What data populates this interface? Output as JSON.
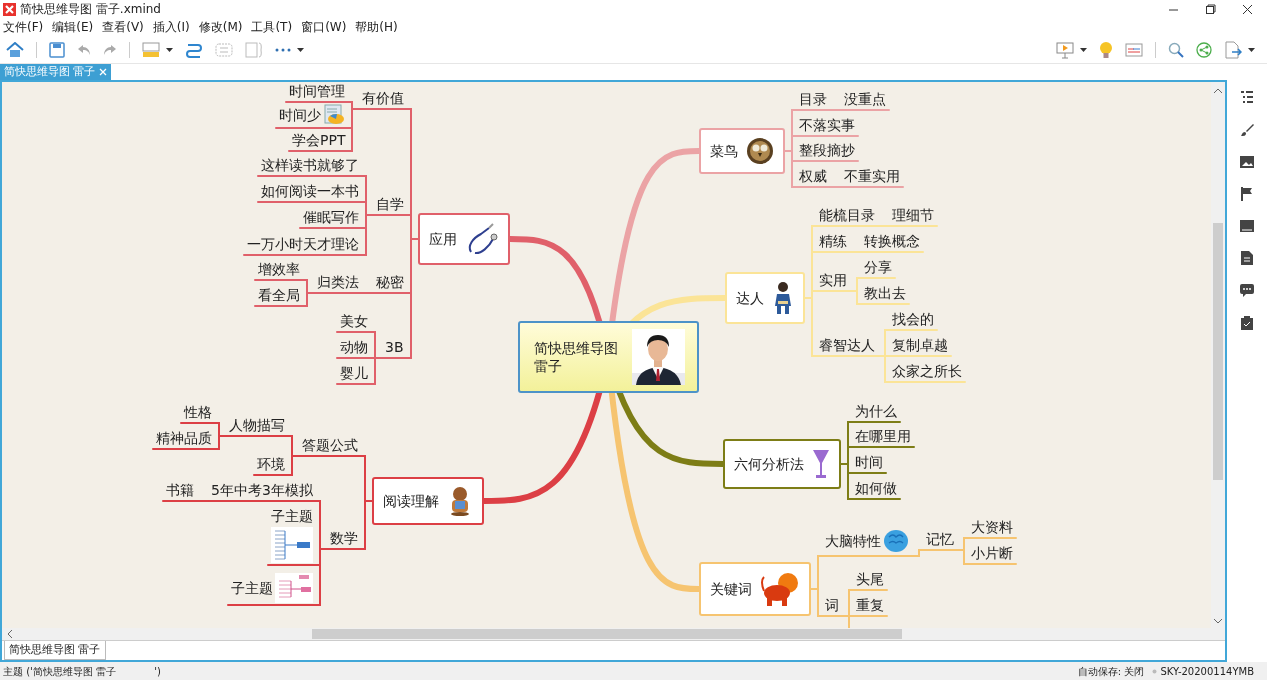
{
  "window": {
    "title": "简快思维导图 雷子.xmind"
  },
  "menu": [
    "文件(F)",
    "编辑(E)",
    "查看(V)",
    "插入(I)",
    "修改(M)",
    "工具(T)",
    "窗口(W)",
    "帮助(H)"
  ],
  "editor_tab": {
    "label": "简快思维导图 雷子"
  },
  "mindmap": {
    "central": {
      "lines": [
        "简快思维导图",
        "雷子"
      ]
    },
    "branches": [
      {
        "label": "应用",
        "color": "#e0606a",
        "children": [
          {
            "label": "有价值",
            "children": [
              {
                "label": "时间管理"
              },
              {
                "label": "时间少"
              },
              {
                "label": "学会PPT"
              }
            ]
          },
          {
            "label": "自学",
            "children": [
              {
                "label": "这样读书就够了"
              },
              {
                "label": "如何阅读一本书"
              },
              {
                "label": "催眠写作"
              },
              {
                "label": "一万小时天才理论"
              }
            ]
          },
          {
            "label": "秘密",
            "children": [
              {
                "label": "归类法",
                "children": [
                  {
                    "label": "增效率"
                  },
                  {
                    "label": "看全局"
                  }
                ]
              }
            ]
          },
          {
            "label": "3B",
            "children": [
              {
                "label": "美女"
              },
              {
                "label": "动物"
              },
              {
                "label": "婴儿"
              }
            ]
          }
        ]
      },
      {
        "label": "阅读理解",
        "color": "#dc3f45",
        "children": [
          {
            "label": "答题公式",
            "children": [
              {
                "label": "人物描写",
                "children": [
                  {
                    "label": "性格"
                  },
                  {
                    "label": "精神品质"
                  }
                ]
              },
              {
                "label": "环境"
              }
            ]
          },
          {
            "label": "数学",
            "children": [
              {
                "label": "5年中考3年模拟",
                "children": [
                  {
                    "label": "书籍"
                  }
                ]
              },
              {
                "label": "子主题"
              },
              {
                "label": "子主题"
              }
            ]
          }
        ]
      },
      {
        "label": "菜鸟",
        "color": "#eba3a5",
        "children": [
          {
            "label": "目录",
            "children": [
              {
                "label": "没重点"
              }
            ]
          },
          {
            "label": "不落实事"
          },
          {
            "label": "整段摘抄"
          },
          {
            "label": "权威",
            "children": [
              {
                "label": "不重实用"
              }
            ]
          }
        ]
      },
      {
        "label": "达人",
        "color": "#fbe497",
        "children": [
          {
            "label": "能梳目录",
            "children": [
              {
                "label": "理细节"
              }
            ]
          },
          {
            "label": "精练",
            "children": [
              {
                "label": "转换概念"
              }
            ]
          },
          {
            "label": "实用",
            "children": [
              {
                "label": "分享"
              },
              {
                "label": "教出去"
              }
            ]
          },
          {
            "label": "睿智达人",
            "children": [
              {
                "label": "找会的"
              },
              {
                "label": "复制卓越"
              },
              {
                "label": "众家之所长"
              }
            ]
          }
        ]
      },
      {
        "label": "六何分析法",
        "color": "#7d7d16",
        "children": [
          {
            "label": "为什么"
          },
          {
            "label": "在哪里用"
          },
          {
            "label": "时间"
          },
          {
            "label": "如何做"
          }
        ]
      },
      {
        "label": "关键词",
        "color": "#f6c470",
        "children": [
          {
            "label": "大脑特性",
            "children": [
              {
                "label": "记忆",
                "children": [
                  {
                    "label": "大资料"
                  },
                  {
                    "label": "小片断"
                  }
                ]
              }
            ]
          },
          {
            "label": "词",
            "children": [
              {
                "label": "头尾"
              },
              {
                "label": "重复"
              }
            ]
          }
        ]
      }
    ]
  },
  "sheet_tab": {
    "label": "简快思维导图 雷子"
  },
  "status_bar": {
    "topic": "主题 ('简快思维导图 雷子            ')",
    "autosave": "自动保存: 关闭",
    "machine": "SKY-20200114YMB"
  }
}
